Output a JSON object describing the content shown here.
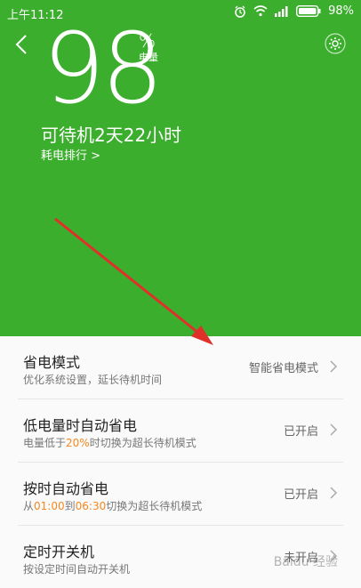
{
  "status_bar": {
    "time": "上午11:12",
    "battery_percent": "98%",
    "icons": [
      "alarm-icon",
      "wifi-icon",
      "signal-icon",
      "battery-icon"
    ]
  },
  "header": {
    "battery_level": "98",
    "percent_sign": "%",
    "battery_label": "电量",
    "standby_text": "可待机2天22小时",
    "rank_link": "耗电排行 >",
    "accent_color": "#3cae2e"
  },
  "settings": [
    {
      "title": "省电模式",
      "subtitle": "优化系统设置，延长待机时间",
      "value": "智能省电模式"
    },
    {
      "title": "低电量时自动省电",
      "subtitle_prefix": "电量低于",
      "subtitle_highlight": "20%",
      "subtitle_suffix": "时切换为超长待机模式",
      "value": "已开启"
    },
    {
      "title": "按时自动省电",
      "subtitle_prefix": "从",
      "subtitle_highlight1": "01:00",
      "subtitle_mid": "到",
      "subtitle_highlight2": "06:30",
      "subtitle_suffix": "切换为超长待机模式",
      "value": "已开启"
    },
    {
      "title": "定时开关机",
      "subtitle": "按设定时间自动开关机",
      "value": "未开启"
    }
  ],
  "highlight_color": "#f5881f",
  "watermark": "Baidu 经验"
}
